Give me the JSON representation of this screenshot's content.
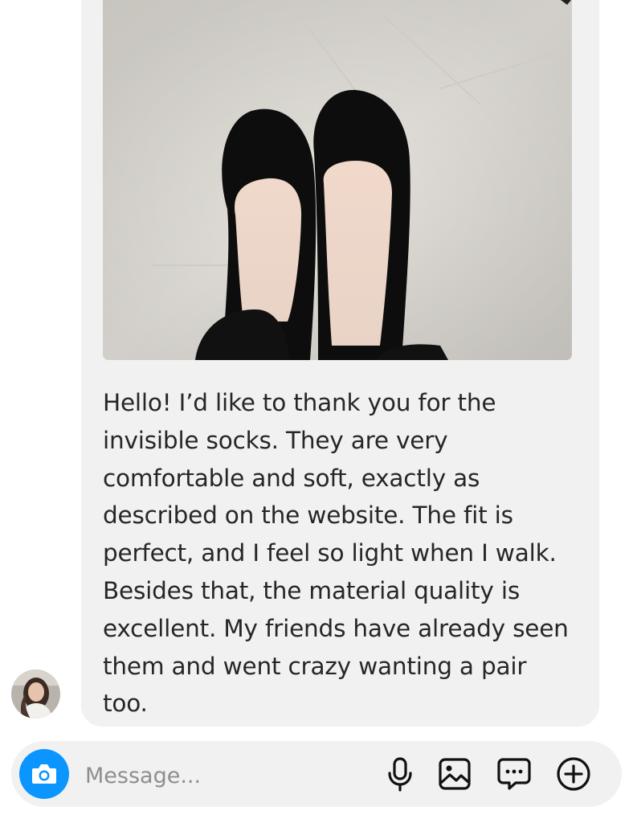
{
  "chat": {
    "message": {
      "text": "Hello! I’d like to thank you for the invisible socks. They are very comfortable and soft, exactly as described on the website. The fit is perfect, and I feel so light when I walk. Besides that, the material quality is excellent. My friends have already seen them and went crazy wanting a pair too."
    }
  },
  "composer": {
    "placeholder": "Message...",
    "icons": [
      "camera-icon",
      "microphone-icon",
      "gallery-icon",
      "sticker-icon",
      "plus-icon"
    ]
  },
  "colors": {
    "bubble": "#f1f1f2",
    "accent": "#0a95ff",
    "text": "#262626"
  }
}
